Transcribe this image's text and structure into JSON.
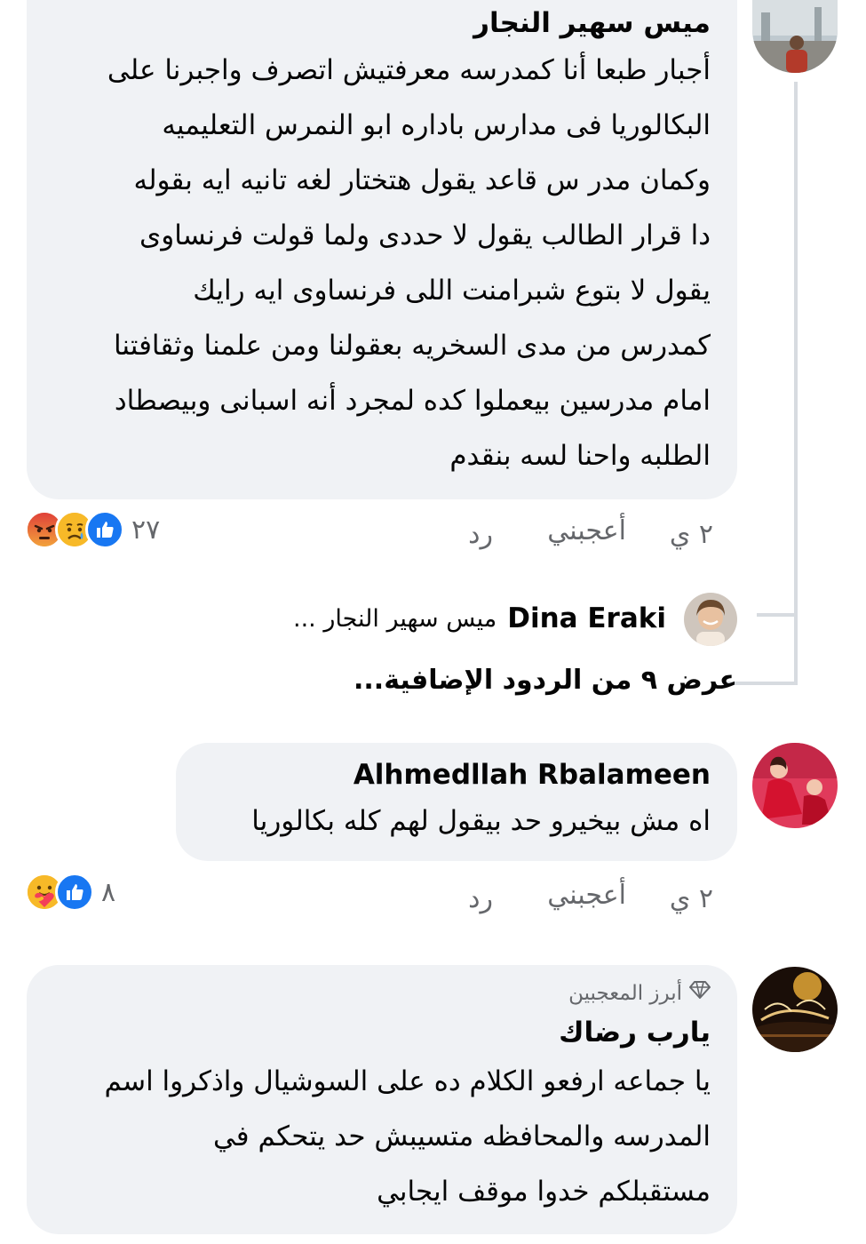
{
  "comments": [
    {
      "author": "ميس سهير النجار",
      "lines": [
        "أجبار طبعا أنا كمدرسه معرفتيش اتصرف واجبرنا على",
        "البكالوريا فى مدارس باداره ابو النمرس التعليميه",
        "وكمان مدر س قاعد يقول هتختار لغه تانيه ايه بقوله",
        "دا قرار الطالب يقول لا حددى ولما قولت فرنساوى",
        "يقول لا بتوع شبرامنت اللى فرنساوى ايه رايك",
        "كمدرس من مدى السخريه بعقولنا ومن علمنا وثقافتنا",
        "امام مدرسين بيعملوا كده لمجرد أنه اسبانى وبيصطاد",
        "الطلبه واحنا لسه بنقدم"
      ],
      "time": "٢ ي",
      "like_label": "أعجبني",
      "reply_label": "رد",
      "reaction_count": "٢٧",
      "reactions": [
        "like-icon",
        "sad-icon",
        "angry-icon"
      ]
    },
    {
      "author": "Alhmedllah Rbalameen",
      "lines": [
        "اه مش بيخيرو حد بيقول لهم كله بكالوريا"
      ],
      "time": "٢ ي",
      "like_label": "أعجبني",
      "reply_label": "رد",
      "reaction_count": "٨",
      "reactions": [
        "like-icon",
        "care-icon"
      ]
    },
    {
      "badge": "أبرز المعجبين",
      "author": "يارب رضاك",
      "lines": [
        "يا جماعه ارفعو الكلام ده على السوشيال واذكروا اسم",
        "المدرسه والمحافظه متسيبش حد يتحكم في",
        "مستقبلكم خدوا موقف ايجابي"
      ]
    }
  ],
  "reply_preview": {
    "name": "Dina Eraki",
    "snippet": "ميس سهير النجار ..."
  },
  "more_replies": "عرض ٩ من الردود الإضافية...",
  "colors": {
    "bubble": "#f0f2f5",
    "like_blue": "#1877f2",
    "muted_text": "#65676b",
    "thread_line": "#d7dbe0"
  }
}
